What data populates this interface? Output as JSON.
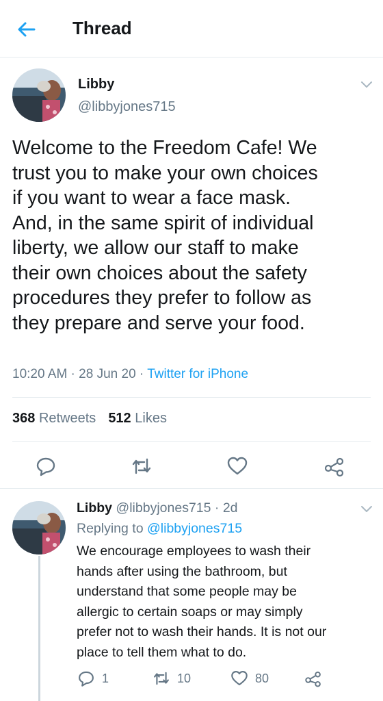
{
  "header": {
    "title": "Thread"
  },
  "tweet": {
    "name": "Libby",
    "handle": "@libbyjones715",
    "text": "Welcome to the Freedom Cafe! We\ntrust you to make your own choices\nif you want to wear a face mask.\nAnd, in the same spirit of individual\nliberty, we allow our staff to make\ntheir own choices about the safety\nprocedures they prefer to follow as\nthey prepare and serve your food.",
    "time": "10:20 AM",
    "sep1": " · ",
    "date": "28 Jun 20",
    "sep2": " · ",
    "source": "Twitter for iPhone",
    "retweets": "368",
    "retweets_label": "Retweets",
    "likes": "512",
    "likes_label": "Likes"
  },
  "reply": {
    "name": "Libby",
    "handle": "@libbyjones715",
    "age": " · 2d",
    "replying_prefix": "Replying to ",
    "replying_to": "@libbyjones715",
    "text": "We encourage employees to wash their\nhands after using the bathroom, but\nunderstand that some people may be\nallergic to certain soaps or may simply\nprefer not to wash their hands. It is not our\nplace to tell them what to do.",
    "replies": "1",
    "retweets": "10",
    "likes": "80"
  },
  "icons": {
    "back": "arrow-left-icon",
    "caret": "chevron-down-icon",
    "reply": "comment-icon",
    "retweet": "retweet-icon",
    "like": "heart-icon",
    "share": "share-icon"
  },
  "colors": {
    "accent": "#1da1f2",
    "text": "#14171a",
    "secondary": "#657786",
    "divider": "#e6ecf0"
  }
}
